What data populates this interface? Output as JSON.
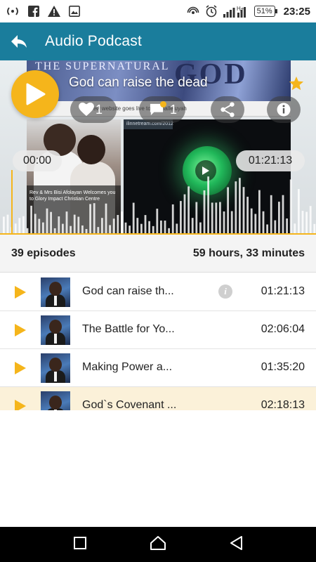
{
  "status_bar": {
    "battery": "51%",
    "time": "23:25"
  },
  "app_bar": {
    "title": "Audio Podcast"
  },
  "hero": {
    "banner_word_1": "THE SUPERNATURAL",
    "banner_word_2": "GOD",
    "strip_text": "new website goes live today halleluyah",
    "photo_caption": "Rev & Mrs Bisi Afolayan Welcomes you to Glory Impact Christian Centre",
    "video_link": "ilinnetream.com/2012",
    "episode_title": "God can raise the dead",
    "likes": "1",
    "comments": "1",
    "elapsed": "00:00",
    "duration": "01:21:13",
    "accent": "#f5b51b"
  },
  "summary": {
    "episodes": "39 episodes",
    "total_time": "59 hours, 33 minutes"
  },
  "episodes": [
    {
      "title": "God can raise th...",
      "duration": "01:21:13",
      "has_info": true,
      "active": false
    },
    {
      "title": "The Battle for Yo...",
      "duration": "02:06:04",
      "has_info": false,
      "active": false
    },
    {
      "title": "Making Power a...",
      "duration": "01:35:20",
      "has_info": false,
      "active": false
    },
    {
      "title": "God`s Covenant ...",
      "duration": "02:18:13",
      "has_info": false,
      "active": true
    }
  ],
  "icons": {
    "back": "back-arrow-icon",
    "star": "star-icon",
    "heart": "heart-icon",
    "comment": "comment-icon",
    "share": "share-icon",
    "info": "info-icon"
  }
}
